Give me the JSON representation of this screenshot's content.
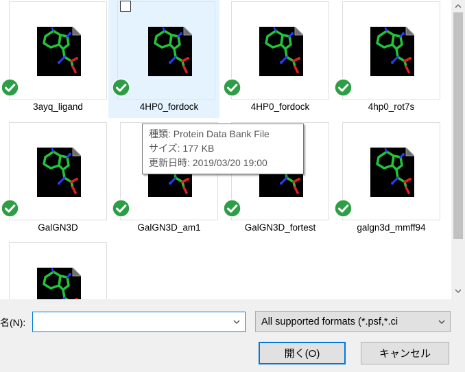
{
  "files": [
    {
      "name": "3ayq_ligand",
      "synced": true
    },
    {
      "name": "4HP0_fordock",
      "synced": true,
      "selected": true
    },
    {
      "name": "4HP0_fordock",
      "synced": true
    },
    {
      "name": "4hp0_rot7s",
      "synced": true
    },
    {
      "name": "GalGN3D",
      "synced": true
    },
    {
      "name": "GalGN3D_am1",
      "synced": true
    },
    {
      "name": "GalGN3D_fortest",
      "synced": true
    },
    {
      "name": "galgn3d_mmff94",
      "synced": true
    },
    {
      "name": "",
      "synced": false
    }
  ],
  "tooltip": {
    "type_line": "種類: Protein Data Bank File",
    "size_line": "サイズ: 177 KB",
    "date_line": "更新日時: 2019/03/20 19:00"
  },
  "filename": {
    "label": "名(N):",
    "value": ""
  },
  "filetype": {
    "selected": "All supported formats (*.psf,*.ci"
  },
  "buttons": {
    "open": "開く(O)",
    "cancel": "キャンセル"
  },
  "colors": {
    "selection_bg": "#e5f3ff",
    "accent": "#0078d7",
    "sync_green": "#2e9e46",
    "molecule_green": "#22c43a",
    "molecule_blue": "#2a3cff",
    "molecule_red": "#e02020"
  },
  "icons": {
    "sync": "green-check-circle",
    "file": "molecule-document"
  }
}
